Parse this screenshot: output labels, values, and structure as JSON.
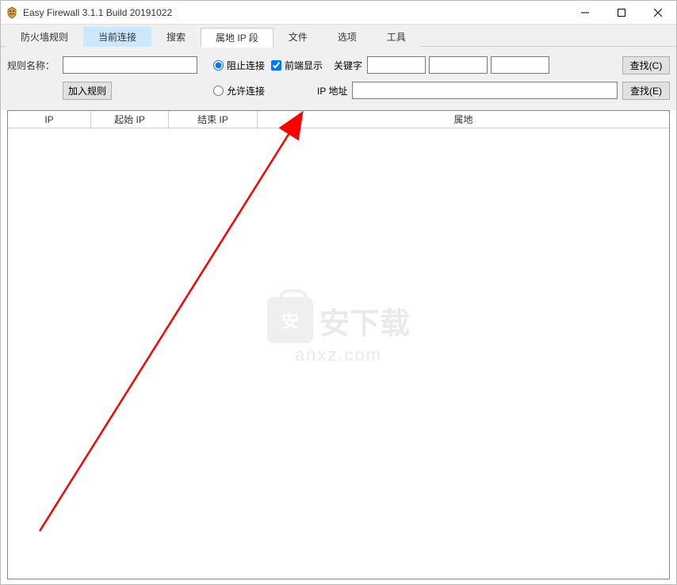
{
  "window": {
    "title": "Easy Firewall 3.1.1 Build 20191022"
  },
  "tabs": [
    {
      "label": "防火墙规则",
      "active": false,
      "highlight": false
    },
    {
      "label": "当前连接",
      "active": false,
      "highlight": true
    },
    {
      "label": "搜索",
      "active": false,
      "highlight": false
    },
    {
      "label": "属地 IP 段",
      "active": true,
      "highlight": false
    },
    {
      "label": "文件",
      "active": false,
      "highlight": false
    },
    {
      "label": "选项",
      "active": false,
      "highlight": false
    },
    {
      "label": "工具",
      "active": false,
      "highlight": false
    }
  ],
  "form": {
    "rule_name_label": "规则名称：",
    "rule_name_value": "",
    "add_rule_label": "加入规则",
    "radio_block": "阻止连接",
    "radio_allow": "允许连接",
    "radio_selected": "block",
    "checkbox_front": "前端显示",
    "checkbox_front_checked": true,
    "keyword_label": "关键字",
    "kw1": "",
    "kw2": "",
    "kw3": "",
    "search_c_label": "查找(C)",
    "ip_addr_label": "IP 地址",
    "ip_addr_value": "",
    "search_e_label": "查找(E)"
  },
  "table": {
    "columns": [
      "IP",
      "起始 IP",
      "结束 IP",
      "属地"
    ],
    "rows": []
  },
  "watermark": {
    "main": "安下载",
    "sub": "anxz.com",
    "badge": "安"
  }
}
